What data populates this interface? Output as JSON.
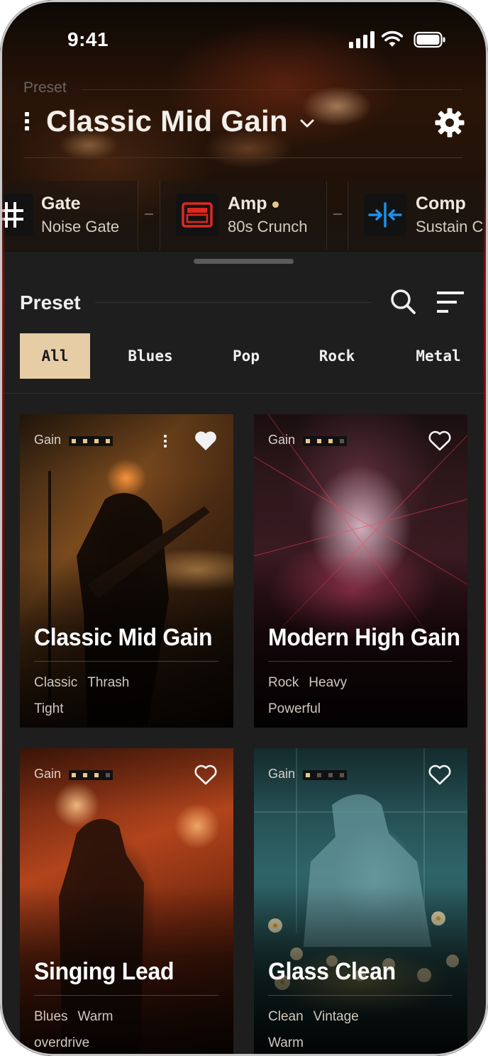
{
  "status_bar": {
    "time": "9:41"
  },
  "header": {
    "section_label": "Preset",
    "preset_name": "Classic Mid Gain"
  },
  "signal_chain": [
    {
      "name": "Gate",
      "model": "Noise Gate",
      "icon": "gate-grid-icon",
      "active_dot": false
    },
    {
      "name": "Amp",
      "model": "80s Crunch",
      "icon": "amp-icon",
      "active_dot": true
    },
    {
      "name": "Comp",
      "model": "Sustain C",
      "icon": "compressor-icon",
      "active_dot": false
    }
  ],
  "browser": {
    "title": "Preset",
    "filters": [
      "All",
      "Blues",
      "Pop",
      "Rock",
      "Metal"
    ],
    "active_filter": "All"
  },
  "presets": [
    {
      "gain_label": "Gain",
      "gain_level": 4,
      "gain_max": 4,
      "name": "Classic Mid Gain",
      "tags": [
        "Classic",
        "Thrash",
        "Tight"
      ],
      "favorite": true,
      "selected": true
    },
    {
      "gain_label": "Gain",
      "gain_level": 3,
      "gain_max": 4,
      "name": "Modern High Gain",
      "tags": [
        "Rock",
        "Heavy",
        "Powerful"
      ],
      "favorite": false,
      "selected": false
    },
    {
      "gain_label": "Gain",
      "gain_level": 3,
      "gain_max": 4,
      "name": "Singing Lead",
      "tags": [
        "Blues",
        "Warm",
        "overdrive"
      ],
      "favorite": false,
      "selected": false
    },
    {
      "gain_label": "Gain",
      "gain_level": 1,
      "gain_max": 4,
      "name": "Glass Clean",
      "tags": [
        "Clean",
        "Vintage",
        "Warm"
      ],
      "favorite": false,
      "selected": false
    }
  ],
  "colors": {
    "accent": "#e6cda5",
    "sheet_bg": "#1e1e1e",
    "amp_icon_red": "#e0271f",
    "comp_icon_blue": "#1f8fe8"
  }
}
